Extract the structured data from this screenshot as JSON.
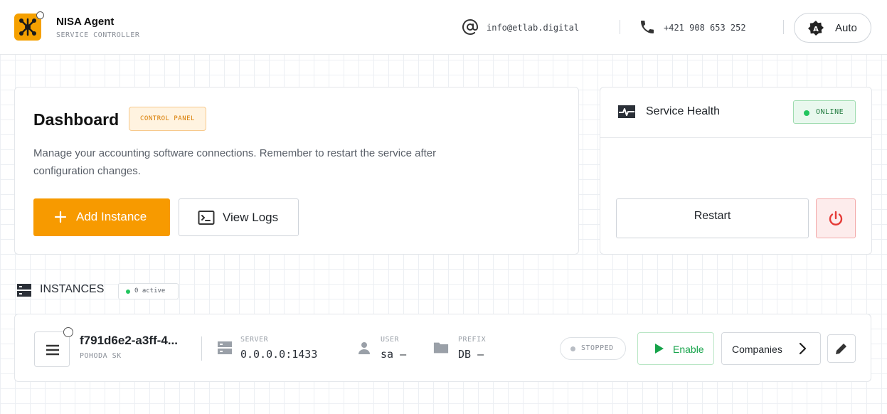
{
  "header": {
    "brand_name": "NISA Agent",
    "brand_sub": "SERVICE CONTROLLER",
    "email": "info@etlab.digital",
    "phone": "+421 908 653 252",
    "theme_label": "Auto"
  },
  "dashboard": {
    "title": "Dashboard",
    "badge": "CONTROL PANEL",
    "description": "Manage your accounting software connections. Remember to restart the service after configuration changes.",
    "add_instance_label": "Add Instance",
    "view_logs_label": "View Logs"
  },
  "health": {
    "title": "Service Health",
    "status": "ONLINE",
    "restart_label": "Restart"
  },
  "instances": {
    "label": "INSTANCES",
    "active_badge": "0 active",
    "items": [
      {
        "id": "f791d6e2-a3ff-4...",
        "software": "POHODA SK",
        "server_label": "SERVER",
        "server_value": "0.0.0.0:1433",
        "user_label": "USER",
        "user_value": "sa —",
        "prefix_label": "PREFIX",
        "prefix_value": "DB —",
        "status": "STOPPED",
        "enable_label": "Enable",
        "companies_label": "Companies"
      }
    ]
  },
  "colors": {
    "accent": "#f79a00",
    "online": "#22c55e",
    "danger": "#e53935"
  }
}
